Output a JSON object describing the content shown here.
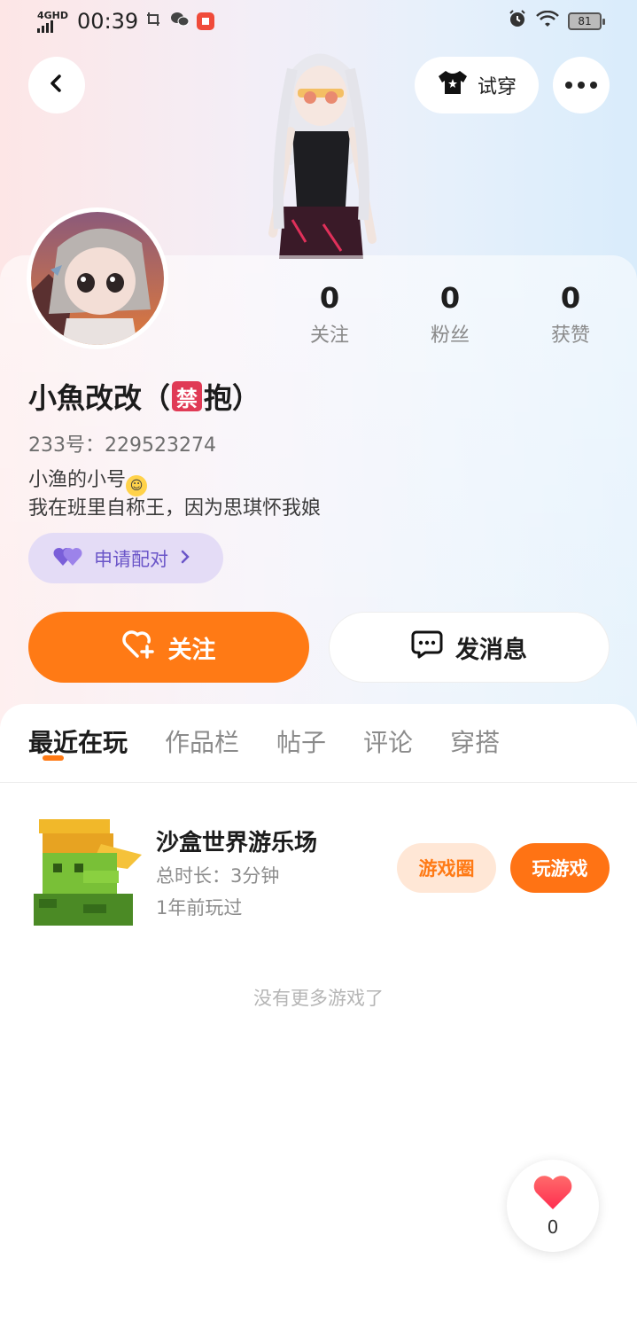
{
  "status_bar": {
    "network": "4GHD",
    "time": "00:39",
    "battery": "81"
  },
  "header": {
    "tryon_label": "试穿"
  },
  "profile": {
    "stats": [
      {
        "value": "0",
        "label": "关注"
      },
      {
        "value": "0",
        "label": "粉丝"
      },
      {
        "value": "0",
        "label": "获赞"
      }
    ],
    "nickname_prefix": "小魚改改（",
    "nickname_emoji": "禁",
    "nickname_suffix": "抱）",
    "uid": "233号：229523274",
    "bio_line1": "小渔的小号",
    "bio_line2": "我在班里自称王，因为思琪怀我娘",
    "pair_label": "申请配对"
  },
  "actions": {
    "follow_label": "关注",
    "message_label": "发消息"
  },
  "tabs": [
    "最近在玩",
    "作品栏",
    "帖子",
    "评论",
    "穿搭"
  ],
  "recent_game": {
    "title": "沙盒世界游乐场",
    "duration": "总时长：3分钟",
    "last_played": "1年前玩过",
    "circle_label": "游戏圈",
    "play_label": "玩游戏"
  },
  "no_more_text": "没有更多游戏了",
  "like_count": "0",
  "colors": {
    "accent": "#ff7a15",
    "pair_bg": "#e4dcf6",
    "pair_text": "#6a55c8"
  }
}
